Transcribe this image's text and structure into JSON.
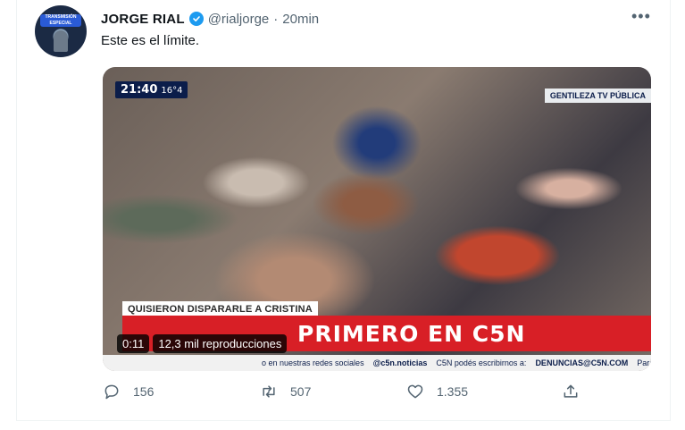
{
  "tweet": {
    "author": {
      "name": "JORGE RIAL",
      "handle": "@rialjorge",
      "separator": "·",
      "time": "20min",
      "avatar_text": "TRANSMISIÓN ESPECIAL"
    },
    "more_label": "•••",
    "text": "Este es el límite.",
    "media": {
      "clock": "21:40",
      "temperature": "16°4",
      "credit": "GENTILEZA TV PÚBLICA",
      "lower_title": "QUISIERON DISPARARLE A CRISTINA",
      "banner": "PRIMERO EN C5N",
      "ticker": {
        "left": "o en nuestras redes sociales",
        "social": "@c5n.noticias",
        "middle": "C5N podés escribirnos a:",
        "email": "DENUNCIAS@C5N.COM",
        "right": "Para co"
      },
      "duration": "0:11",
      "views": "12,3 mil reproducciones"
    },
    "actions": {
      "replies": "156",
      "retweets": "507",
      "likes": "1.355"
    }
  },
  "colors": {
    "verified": "#1d9bf0",
    "muted_text": "#536471",
    "banner_red": "#d81f26"
  }
}
